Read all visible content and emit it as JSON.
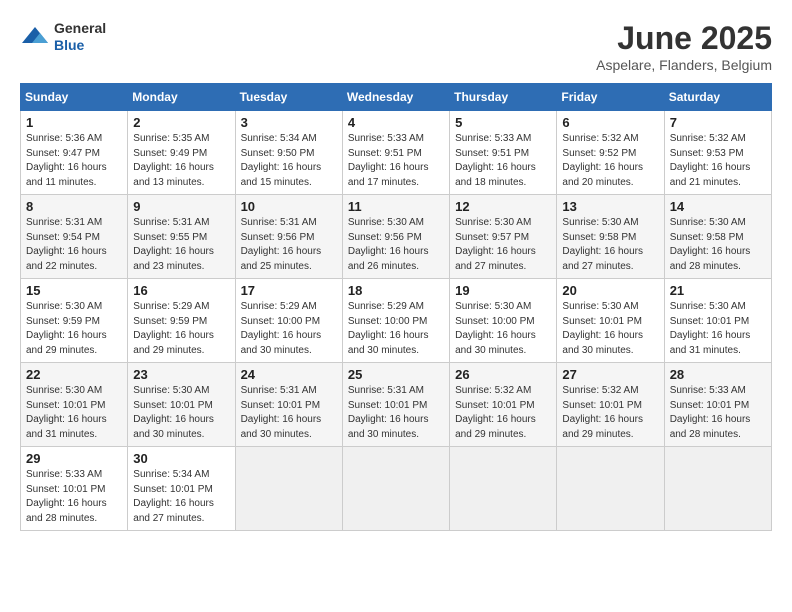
{
  "header": {
    "logo_general": "General",
    "logo_blue": "Blue",
    "month_title": "June 2025",
    "subtitle": "Aspelare, Flanders, Belgium"
  },
  "days_of_week": [
    "Sunday",
    "Monday",
    "Tuesday",
    "Wednesday",
    "Thursday",
    "Friday",
    "Saturday"
  ],
  "weeks": [
    [
      {
        "day": "1",
        "sunrise": "5:36 AM",
        "sunset": "9:47 PM",
        "daylight": "16 hours and 11 minutes."
      },
      {
        "day": "2",
        "sunrise": "5:35 AM",
        "sunset": "9:49 PM",
        "daylight": "16 hours and 13 minutes."
      },
      {
        "day": "3",
        "sunrise": "5:34 AM",
        "sunset": "9:50 PM",
        "daylight": "16 hours and 15 minutes."
      },
      {
        "day": "4",
        "sunrise": "5:33 AM",
        "sunset": "9:51 PM",
        "daylight": "16 hours and 17 minutes."
      },
      {
        "day": "5",
        "sunrise": "5:33 AM",
        "sunset": "9:51 PM",
        "daylight": "16 hours and 18 minutes."
      },
      {
        "day": "6",
        "sunrise": "5:32 AM",
        "sunset": "9:52 PM",
        "daylight": "16 hours and 20 minutes."
      },
      {
        "day": "7",
        "sunrise": "5:32 AM",
        "sunset": "9:53 PM",
        "daylight": "16 hours and 21 minutes."
      }
    ],
    [
      {
        "day": "8",
        "sunrise": "5:31 AM",
        "sunset": "9:54 PM",
        "daylight": "16 hours and 22 minutes."
      },
      {
        "day": "9",
        "sunrise": "5:31 AM",
        "sunset": "9:55 PM",
        "daylight": "16 hours and 23 minutes."
      },
      {
        "day": "10",
        "sunrise": "5:31 AM",
        "sunset": "9:56 PM",
        "daylight": "16 hours and 25 minutes."
      },
      {
        "day": "11",
        "sunrise": "5:30 AM",
        "sunset": "9:56 PM",
        "daylight": "16 hours and 26 minutes."
      },
      {
        "day": "12",
        "sunrise": "5:30 AM",
        "sunset": "9:57 PM",
        "daylight": "16 hours and 27 minutes."
      },
      {
        "day": "13",
        "sunrise": "5:30 AM",
        "sunset": "9:58 PM",
        "daylight": "16 hours and 27 minutes."
      },
      {
        "day": "14",
        "sunrise": "5:30 AM",
        "sunset": "9:58 PM",
        "daylight": "16 hours and 28 minutes."
      }
    ],
    [
      {
        "day": "15",
        "sunrise": "5:30 AM",
        "sunset": "9:59 PM",
        "daylight": "16 hours and 29 minutes."
      },
      {
        "day": "16",
        "sunrise": "5:29 AM",
        "sunset": "9:59 PM",
        "daylight": "16 hours and 29 minutes."
      },
      {
        "day": "17",
        "sunrise": "5:29 AM",
        "sunset": "10:00 PM",
        "daylight": "16 hours and 30 minutes."
      },
      {
        "day": "18",
        "sunrise": "5:29 AM",
        "sunset": "10:00 PM",
        "daylight": "16 hours and 30 minutes."
      },
      {
        "day": "19",
        "sunrise": "5:30 AM",
        "sunset": "10:00 PM",
        "daylight": "16 hours and 30 minutes."
      },
      {
        "day": "20",
        "sunrise": "5:30 AM",
        "sunset": "10:01 PM",
        "daylight": "16 hours and 30 minutes."
      },
      {
        "day": "21",
        "sunrise": "5:30 AM",
        "sunset": "10:01 PM",
        "daylight": "16 hours and 31 minutes."
      }
    ],
    [
      {
        "day": "22",
        "sunrise": "5:30 AM",
        "sunset": "10:01 PM",
        "daylight": "16 hours and 31 minutes."
      },
      {
        "day": "23",
        "sunrise": "5:30 AM",
        "sunset": "10:01 PM",
        "daylight": "16 hours and 30 minutes."
      },
      {
        "day": "24",
        "sunrise": "5:31 AM",
        "sunset": "10:01 PM",
        "daylight": "16 hours and 30 minutes."
      },
      {
        "day": "25",
        "sunrise": "5:31 AM",
        "sunset": "10:01 PM",
        "daylight": "16 hours and 30 minutes."
      },
      {
        "day": "26",
        "sunrise": "5:32 AM",
        "sunset": "10:01 PM",
        "daylight": "16 hours and 29 minutes."
      },
      {
        "day": "27",
        "sunrise": "5:32 AM",
        "sunset": "10:01 PM",
        "daylight": "16 hours and 29 minutes."
      },
      {
        "day": "28",
        "sunrise": "5:33 AM",
        "sunset": "10:01 PM",
        "daylight": "16 hours and 28 minutes."
      }
    ],
    [
      {
        "day": "29",
        "sunrise": "5:33 AM",
        "sunset": "10:01 PM",
        "daylight": "16 hours and 28 minutes."
      },
      {
        "day": "30",
        "sunrise": "5:34 AM",
        "sunset": "10:01 PM",
        "daylight": "16 hours and 27 minutes."
      },
      null,
      null,
      null,
      null,
      null
    ]
  ]
}
